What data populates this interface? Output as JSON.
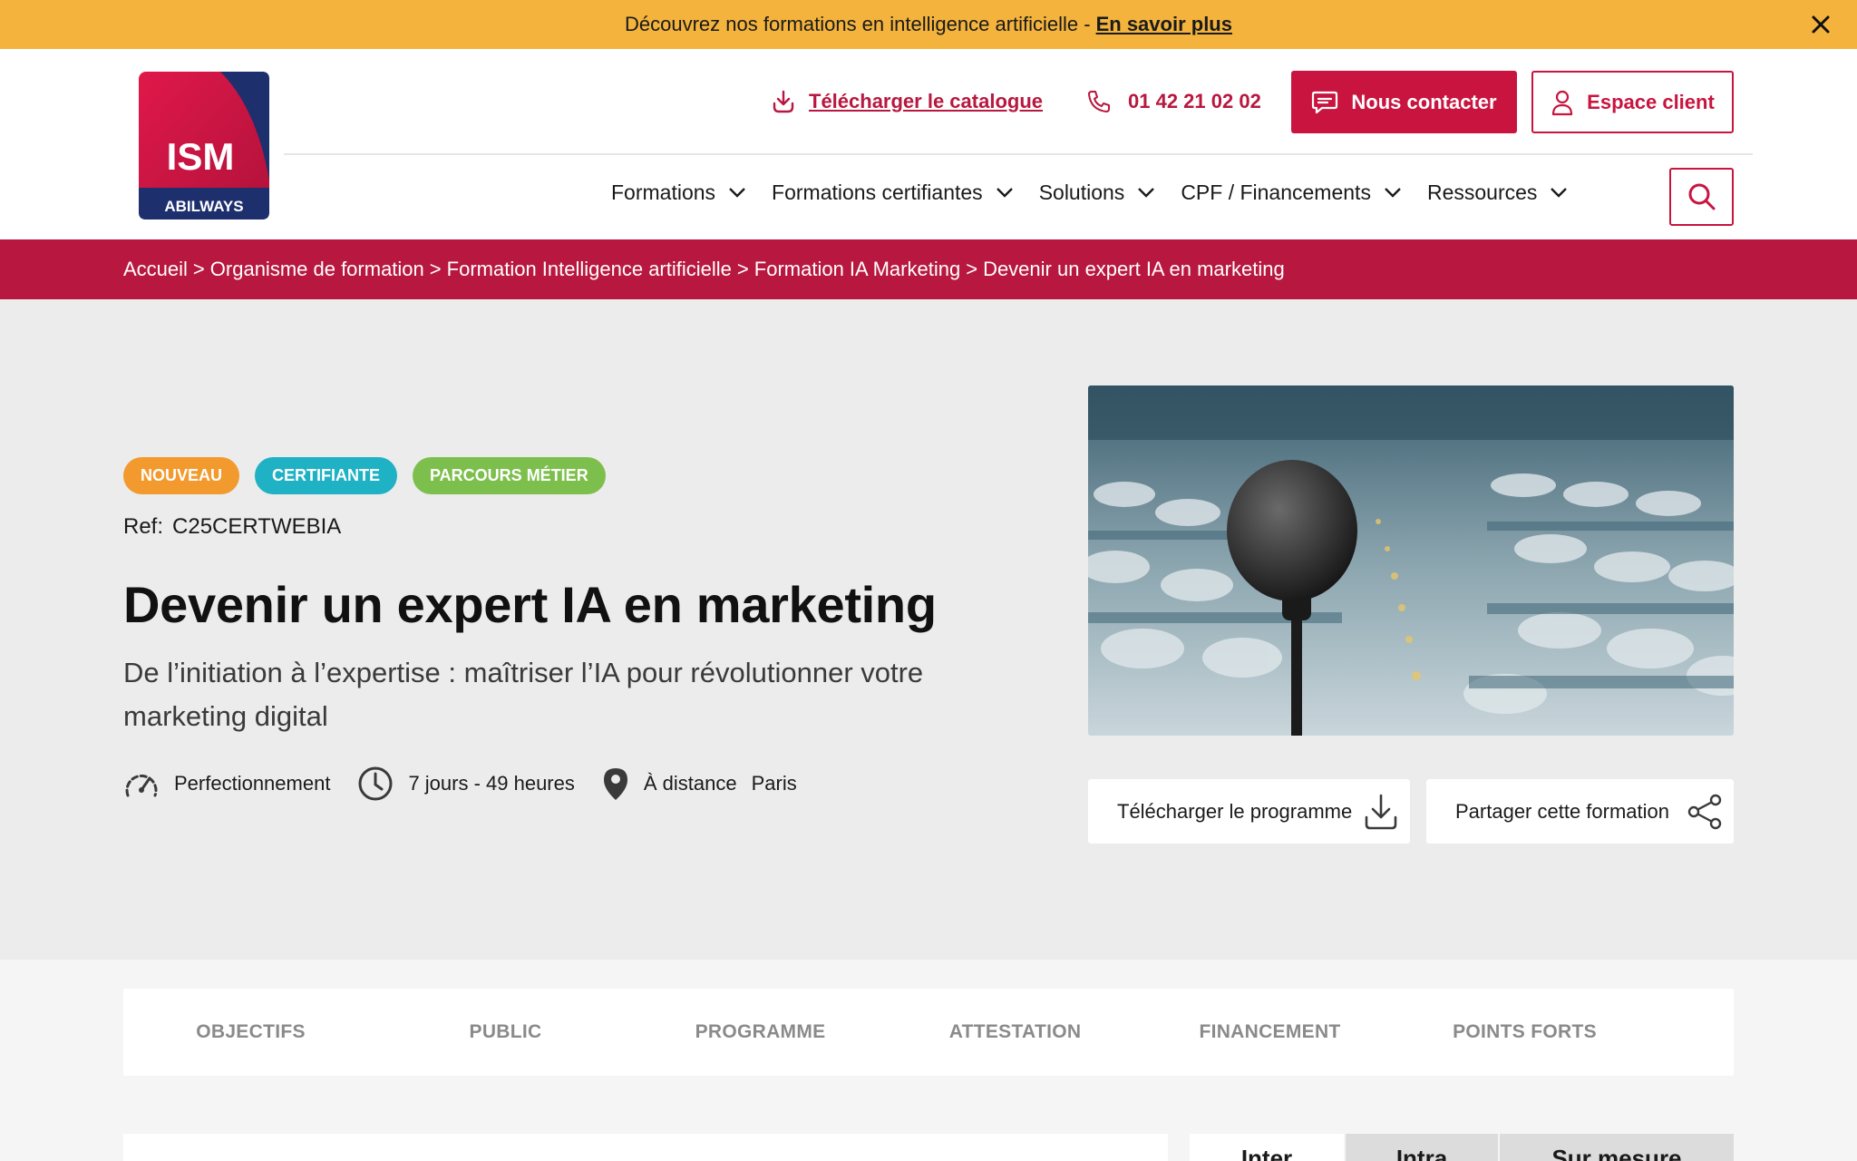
{
  "promo": {
    "text": "Découvrez nos formations en intelligence artificielle -",
    "link": "En savoir plus"
  },
  "logo": {
    "main": "ISM",
    "sub": "ABILWAYS"
  },
  "header": {
    "catalogue": "Télécharger le catalogue",
    "phone": "01 42 21 02 02",
    "contact": "Nous contacter",
    "client": "Espace client"
  },
  "nav": {
    "items": [
      "Formations",
      "Formations certifiantes",
      "Solutions",
      "CPF / Financements",
      "Ressources"
    ]
  },
  "breadcrumb": {
    "items": [
      "Accueil",
      "Organisme de formation",
      "Formation Intelligence artificielle",
      "Formation IA Marketing",
      "Devenir un expert IA en marketing"
    ],
    "separator": ">"
  },
  "hero": {
    "badges": [
      {
        "label": "NOUVEAU",
        "color": "#f29a2e"
      },
      {
        "label": "CERTIFIANTE",
        "color": "#1fb1c4"
      },
      {
        "label": "PARCOURS MÉTIER",
        "color": "#7dbf4c"
      }
    ],
    "ref_label": "Ref:",
    "ref_value": "C25CERTWEBIA",
    "title": "Devenir un expert IA en marketing",
    "subtitle": "De l’initiation à l’expertise : maîtriser l’IA pour révolutionner votre marketing digital",
    "level": "Perfectionnement",
    "duration": "7 jours - 49 heures",
    "location_1": "À distance",
    "location_2": "Paris",
    "download": "Télécharger le programme",
    "share": "Partager cette formation"
  },
  "tabs": [
    "OBJECTIFS",
    "PUBLIC",
    "PROGRAMME",
    "ATTESTATION",
    "FINANCEMENT",
    "POINTS FORTS"
  ],
  "format_tabs": [
    "Inter",
    "Intra",
    "Sur mesure"
  ],
  "colors": {
    "brand": "#c8143f",
    "breadcrumb": "#b8183f",
    "promo": "#f3b33d"
  }
}
